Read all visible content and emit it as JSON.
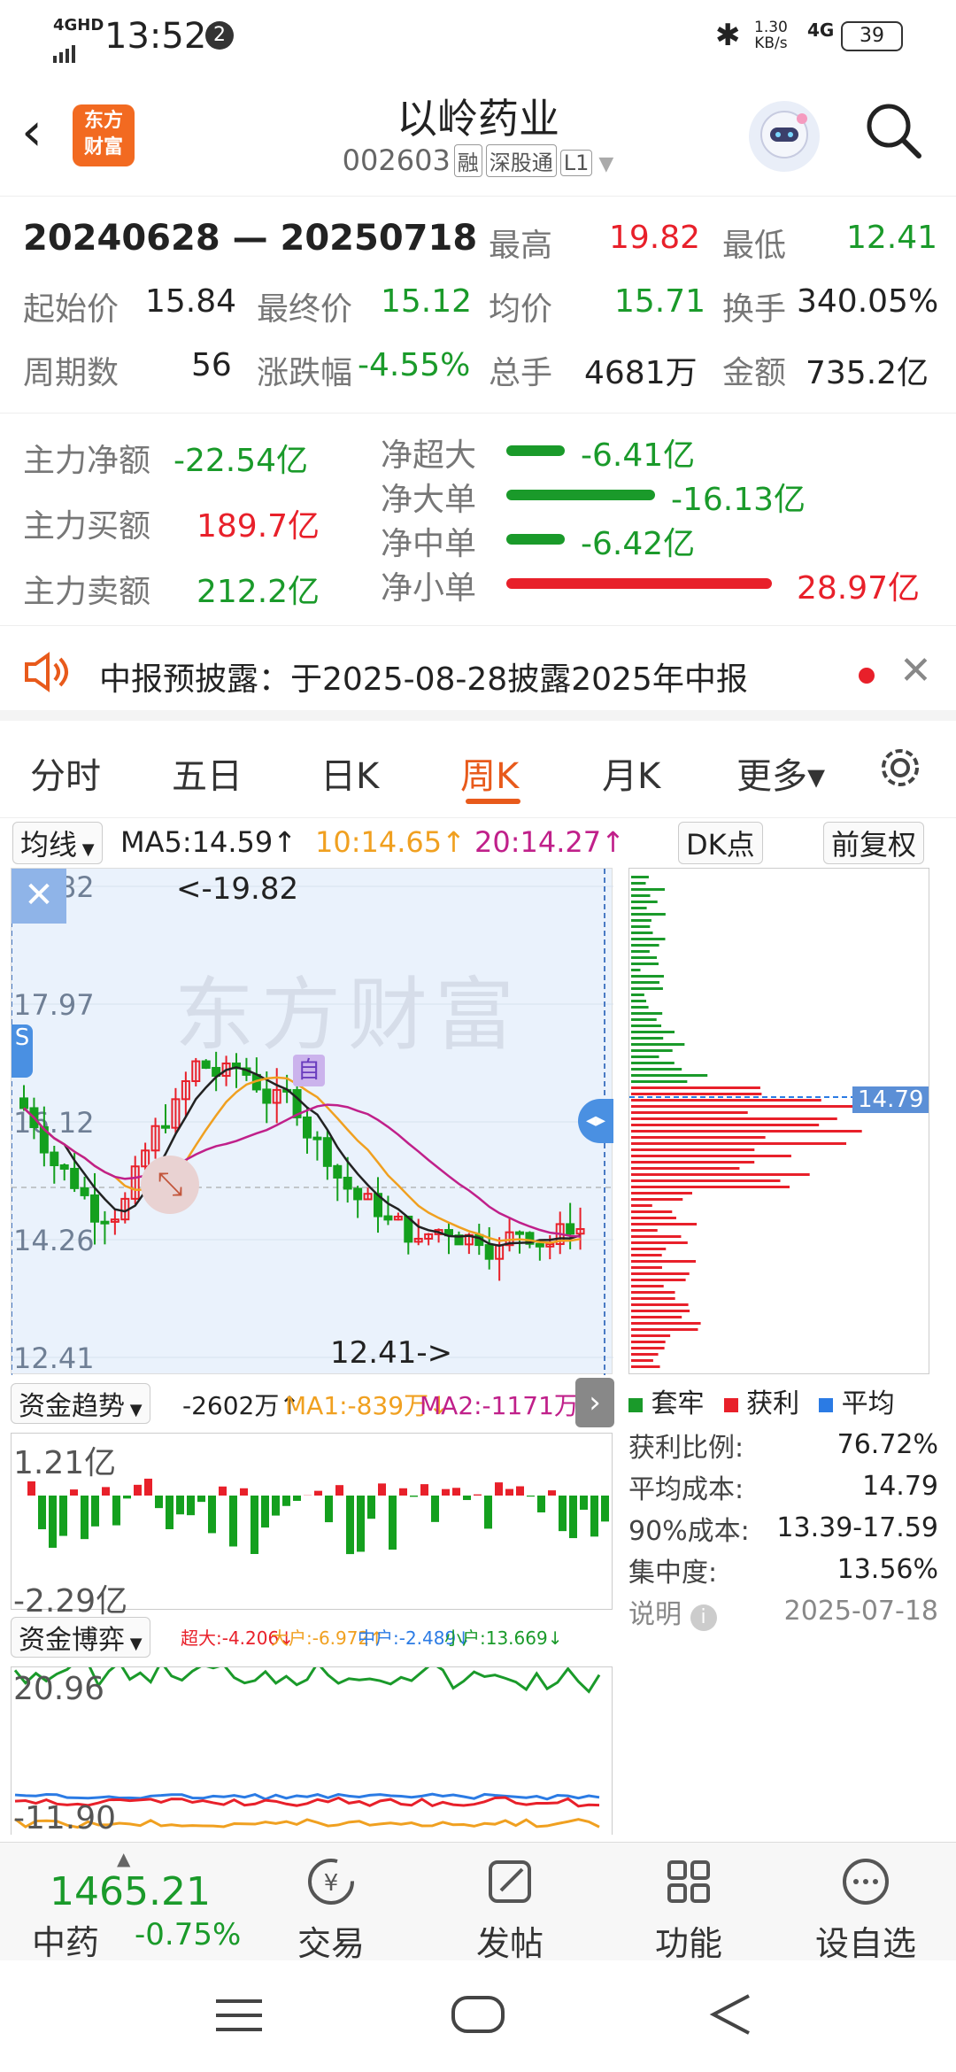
{
  "status": {
    "network": "4GHD",
    "time": "13:52",
    "notif": "2",
    "speed": "1.30\nKB/s",
    "speed_top": "1.30",
    "speed_bot": "KB/s",
    "net2": "4G",
    "battery": "39"
  },
  "header": {
    "title": "以岭药业",
    "code": "002603",
    "tags": [
      "融",
      "深股通",
      "L1"
    ],
    "logo_top": "东方",
    "logo_bot": "财富"
  },
  "summary": {
    "range": "20240628 — 20250718",
    "high_label": "最高",
    "high": "19.82",
    "low_label": "最低",
    "low": "12.41",
    "start_label": "起始价",
    "start": "15.84",
    "end_label": "最终价",
    "end": "15.12",
    "avg_label": "均价",
    "avg": "15.71",
    "turnover_label": "换手",
    "turnover": "340.05%",
    "periods_label": "周期数",
    "periods": "56",
    "change_label": "涨跌幅",
    "change": "-4.55%",
    "volume_label": "总手",
    "volume": "4681万",
    "amount_label": "金额",
    "amount": "735.2亿"
  },
  "flow": {
    "net_label": "主力净额",
    "net": "-22.54亿",
    "buy_label": "主力买额",
    "buy": "189.7亿",
    "sell_label": "主力卖额",
    "sell": "212.2亿",
    "items": [
      {
        "label": "净超大",
        "value": "-6.41亿",
        "fraction": 0.22
      },
      {
        "label": "净大单",
        "value": "-16.13亿",
        "fraction": 0.56
      },
      {
        "label": "净中单",
        "value": "-6.42亿",
        "fraction": 0.22
      },
      {
        "label": "净小单",
        "value": "28.97亿",
        "fraction": 1.0
      }
    ]
  },
  "notice": {
    "text": "中报预披露：于2025-08-28披露2025年中报"
  },
  "tabs": [
    "分时",
    "五日",
    "日K",
    "周K",
    "月K",
    "更多▾"
  ],
  "active_tab": "周K",
  "ma": {
    "type": "均线",
    "ma5": "MA5:14.59↑",
    "ma10": "10:14.65↑",
    "ma20": "20:14.27↑",
    "dk": "DK点",
    "fq": "前复权"
  },
  "kline": {
    "price_labels": [
      "19.82",
      "17.97",
      "16.12",
      "14.26",
      "12.41"
    ],
    "max_label": "<-19.82",
    "min_label": "12.41->",
    "watermark": "东方财富",
    "self_mark": "自"
  },
  "chip": {
    "avg_price": "14.79",
    "legend": [
      "套牢",
      "获利",
      "平均"
    ]
  },
  "chip_info": {
    "rows": [
      {
        "label": "获利比例:",
        "value": "76.72%"
      },
      {
        "label": "平均成本:",
        "value": "14.79"
      },
      {
        "label": "90%成本:",
        "value": "13.39-17.59"
      },
      {
        "label": "集中度:",
        "value": "13.56%"
      }
    ],
    "note": "说明",
    "date": "2025-07-18"
  },
  "fund": {
    "title": "资金趋势",
    "v1": "-2602万↑",
    "ma1": "MA1:-839万↓",
    "ma2": "MA2:-1171万↑",
    "top": "1.21亿",
    "bottom": "-2.29亿"
  },
  "game": {
    "title": "资金博弈",
    "super": "超大:-4.206↓",
    "big": "大户:-6.972↑",
    "mid": "中户:-2.489↓",
    "small": "小户:13.669↓",
    "top": "20.96",
    "bottom": "-11.90"
  },
  "bottom": {
    "index_value": "1465.21",
    "index_name": "中药",
    "index_change": "-0.75%",
    "nav": [
      "交易",
      "发帖",
      "功能",
      "设自选"
    ]
  },
  "colors": {
    "accent": "#e85a1b",
    "up": "#e8202a",
    "down": "#1a9a2a"
  }
}
